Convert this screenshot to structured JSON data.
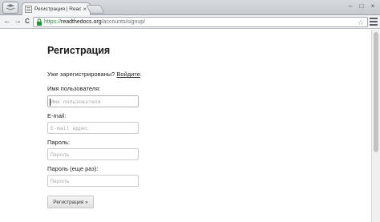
{
  "browser": {
    "tab_title": "Регистрация | Read th",
    "tab_close": "×",
    "url_scheme": "https://",
    "url_host": "readthedocs.org",
    "url_path": "/accounts/signup/",
    "nav_back": "←",
    "nav_forward": "→",
    "nav_reload": "C",
    "star": "☆",
    "win_minimize": "–",
    "win_maximize": "□",
    "win_close": "×"
  },
  "page": {
    "title": "Регистрация",
    "already_registered": "Уже зарегистрированы?",
    "login_link": "Войдите",
    "login_suffix": "."
  },
  "form": {
    "username": {
      "label": "Имя пользователя:",
      "placeholder": "Имя пользователя",
      "value": ""
    },
    "email": {
      "label": "E-mail:",
      "placeholder": "E-mail адрес",
      "value": ""
    },
    "password": {
      "label": "Пароль:",
      "placeholder": "Пароль",
      "value": ""
    },
    "password2": {
      "label": "Пароль (еще раз):",
      "placeholder": "Пароль",
      "value": ""
    },
    "submit_label": "Регистрация »"
  }
}
